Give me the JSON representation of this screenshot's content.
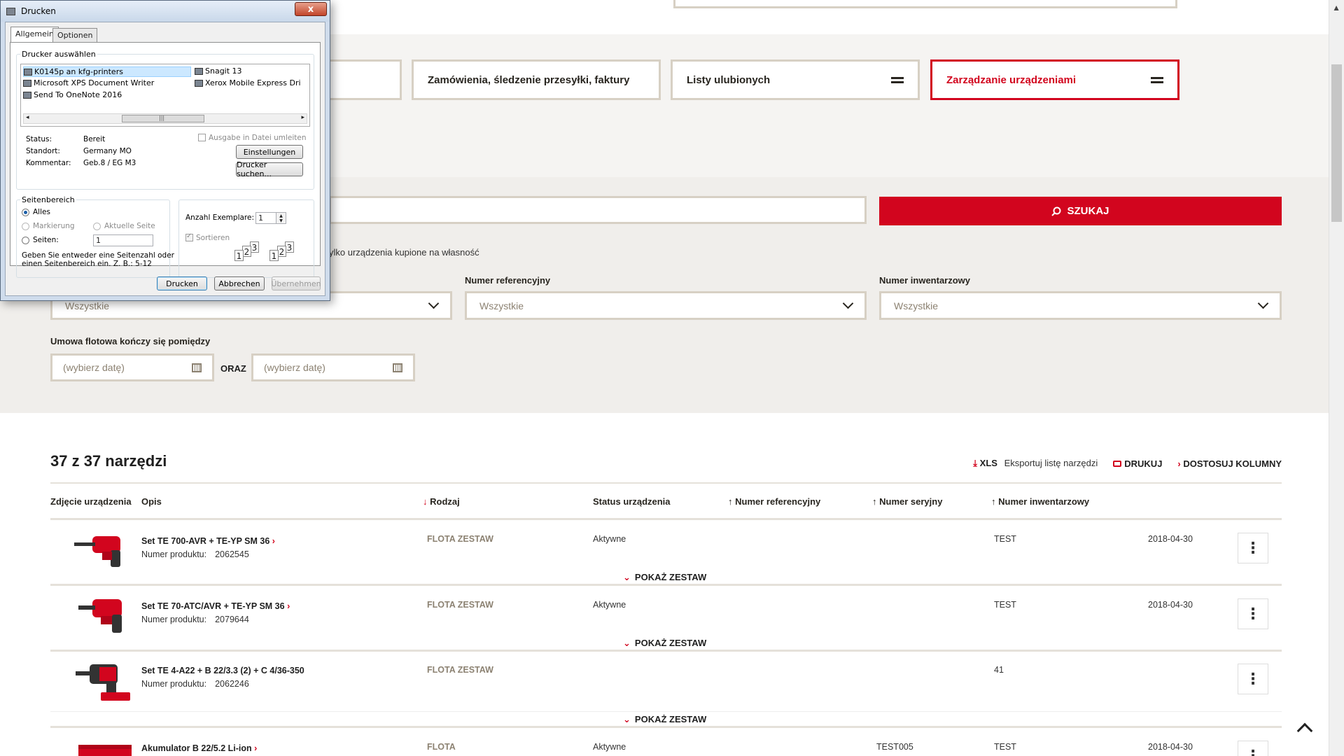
{
  "nav": {
    "tiles": [
      {
        "label": ""
      },
      {
        "label": "Zamówienia, śledzenie przesyłki, faktury"
      },
      {
        "label": "Listy ulubionych"
      },
      {
        "label": "Zarządzanie urządzeniami"
      }
    ]
  },
  "search": {
    "button_label": "SZUKAJ",
    "only_purchased_text": "ylko urządzenia kupione na własność"
  },
  "filters": {
    "reference_label": "Numer referencyjny",
    "inventory_label": "Numer inwentarzowy",
    "select_value": "Wszystkie",
    "fleet_end_label": "Umowa flotowa kończy się pomiędzy",
    "date_placeholder": "(wybierz datę)",
    "and_label": "ORAZ"
  },
  "results": {
    "title": "37 z 37 narzędzi",
    "xls": "XLS",
    "export_label": "Eksportuj listę narzędzi",
    "print_label": "DRUKUJ",
    "customize_label": "DOSTOSUJ KOLUMNY",
    "columns": [
      "Zdjęcie urządzenia",
      "Opis",
      "Rodzaj",
      "Status urządzenia",
      "Numer referencyjny",
      "Numer seryjny",
      "Numer inwentarzowy"
    ],
    "product_number_label": "Numer produktu:",
    "show_set_label": "POKAŻ ZESTAW",
    "rows": [
      {
        "name": "Set TE 700-AVR + TE-YP SM 36",
        "product_number": "2062545",
        "type": "FLOTA ZESTAW",
        "status": "Aktywne",
        "serial": "",
        "inventory": "TEST",
        "date": "2018-04-30"
      },
      {
        "name": "Set TE 70-ATC/AVR + TE-YP SM 36",
        "product_number": "2079644",
        "type": "FLOTA ZESTAW",
        "status": "Aktywne",
        "serial": "",
        "inventory": "TEST",
        "date": "2018-04-30"
      },
      {
        "name": "Set TE 4-A22 + B 22/3.3 (2) + C 4/36-350",
        "product_number": "2062246",
        "type": "FLOTA ZESTAW",
        "status": "",
        "serial": "",
        "inventory": "41",
        "date": ""
      },
      {
        "name": "Akumulator B 22/5.2 Li-ion",
        "product_number": "",
        "type": "FLOTA",
        "status": "Aktywne",
        "serial": "TEST005",
        "inventory": "TEST",
        "date": "2018-04-30"
      }
    ]
  },
  "dialog": {
    "title": "Drucken",
    "close": "x",
    "tabs": [
      "Allgemein",
      "Optionen"
    ],
    "select_printer_label": "Drucker auswählen",
    "printers": [
      "K0145p an kfg-printers",
      "Snagit 13",
      "Microsoft XPS Document Writer",
      "Xerox Mobile Express Dri",
      "Send To OneNote 2016"
    ],
    "scroll_grip": "|||",
    "status_label": "Status:",
    "status_value": "Bereit",
    "location_label": "Standort:",
    "location_value": "Germany MO",
    "comment_label": "Kommentar:",
    "comment_value": "Geb.8 / EG M3",
    "print_to_file": "Ausgabe in Datei umleiten",
    "settings_button": "Einstellungen",
    "find_printer_button": "Drucker suchen...",
    "page_range_label": "Seitenbereich",
    "all": "Alles",
    "selection": "Markierung",
    "current_page": "Aktuelle Seite",
    "pages": "Seiten:",
    "pages_value": "1",
    "help_line1": "Geben Sie entweder eine Seitenzahl oder",
    "help_line2": "einen Seitenbereich ein. Z. B.: 5-12",
    "copies_label": "Anzahl Exemplare:",
    "copies_value": "1",
    "collate": "Sortieren",
    "collate_pages": [
      "1",
      "2",
      "3"
    ],
    "print_button": "Drucken",
    "cancel_button": "Abbrechen",
    "apply_button": "Übernehmen"
  }
}
